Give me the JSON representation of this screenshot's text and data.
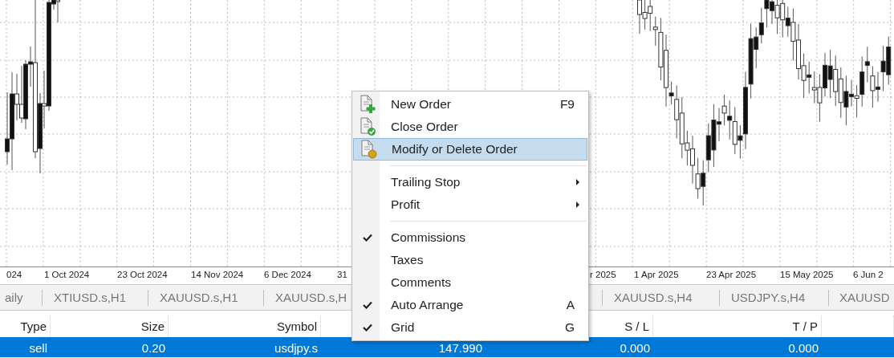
{
  "chart": {
    "dates": [
      "024",
      "1 Oct 2024",
      "23 Oct 2024",
      "14 Nov 2024",
      "6 Dec 2024",
      "31",
      "r 2025",
      "1 Apr 2025",
      "23 Apr 2025",
      "15 May 2025",
      "6 Jun 2"
    ]
  },
  "tabs": [
    {
      "label": "aily"
    },
    {
      "label": "XTIUSD.s,H1"
    },
    {
      "label": "XAUUSD.s,H1"
    },
    {
      "label": "XAUUSD.s,H"
    },
    {
      "label": "XAUUSD.s,H4"
    },
    {
      "label": "USDJPY.s,H4"
    },
    {
      "label": "XAUUSD"
    }
  ],
  "table": {
    "header": {
      "type": "Type",
      "size": "Size",
      "symbol": "Symbol",
      "sl": "S / L",
      "tp": "T / P"
    },
    "rows": [
      {
        "type": "sell",
        "size": "0.20",
        "symbol": "usdjpy.s",
        "column_4": "147.990",
        "sl": "0.000",
        "tp": "0.000",
        "selected": true
      }
    ]
  },
  "context_menu": {
    "items": [
      {
        "kind": "action",
        "label": "New Order",
        "shortcut": "F9",
        "selected": false
      },
      {
        "kind": "action",
        "label": "Close Order",
        "selected": false
      },
      {
        "kind": "action",
        "label": "Modify or Delete Order",
        "selected": true
      },
      {
        "kind": "separator"
      },
      {
        "kind": "submenu",
        "label": "Trailing Stop",
        "selected": false
      },
      {
        "kind": "submenu",
        "label": "Profit",
        "selected": false
      },
      {
        "kind": "separator"
      },
      {
        "kind": "check",
        "label": "Commissions",
        "checked": true,
        "selected": false
      },
      {
        "kind": "check",
        "label": "Taxes",
        "checked": false,
        "selected": false
      },
      {
        "kind": "check",
        "label": "Comments",
        "checked": false,
        "selected": false
      },
      {
        "kind": "check",
        "label": "Auto Arrange",
        "shortcut": "A",
        "checked": true,
        "selected": false
      },
      {
        "kind": "check",
        "label": "Grid",
        "shortcut": "G",
        "checked": true,
        "selected": false
      }
    ]
  }
}
